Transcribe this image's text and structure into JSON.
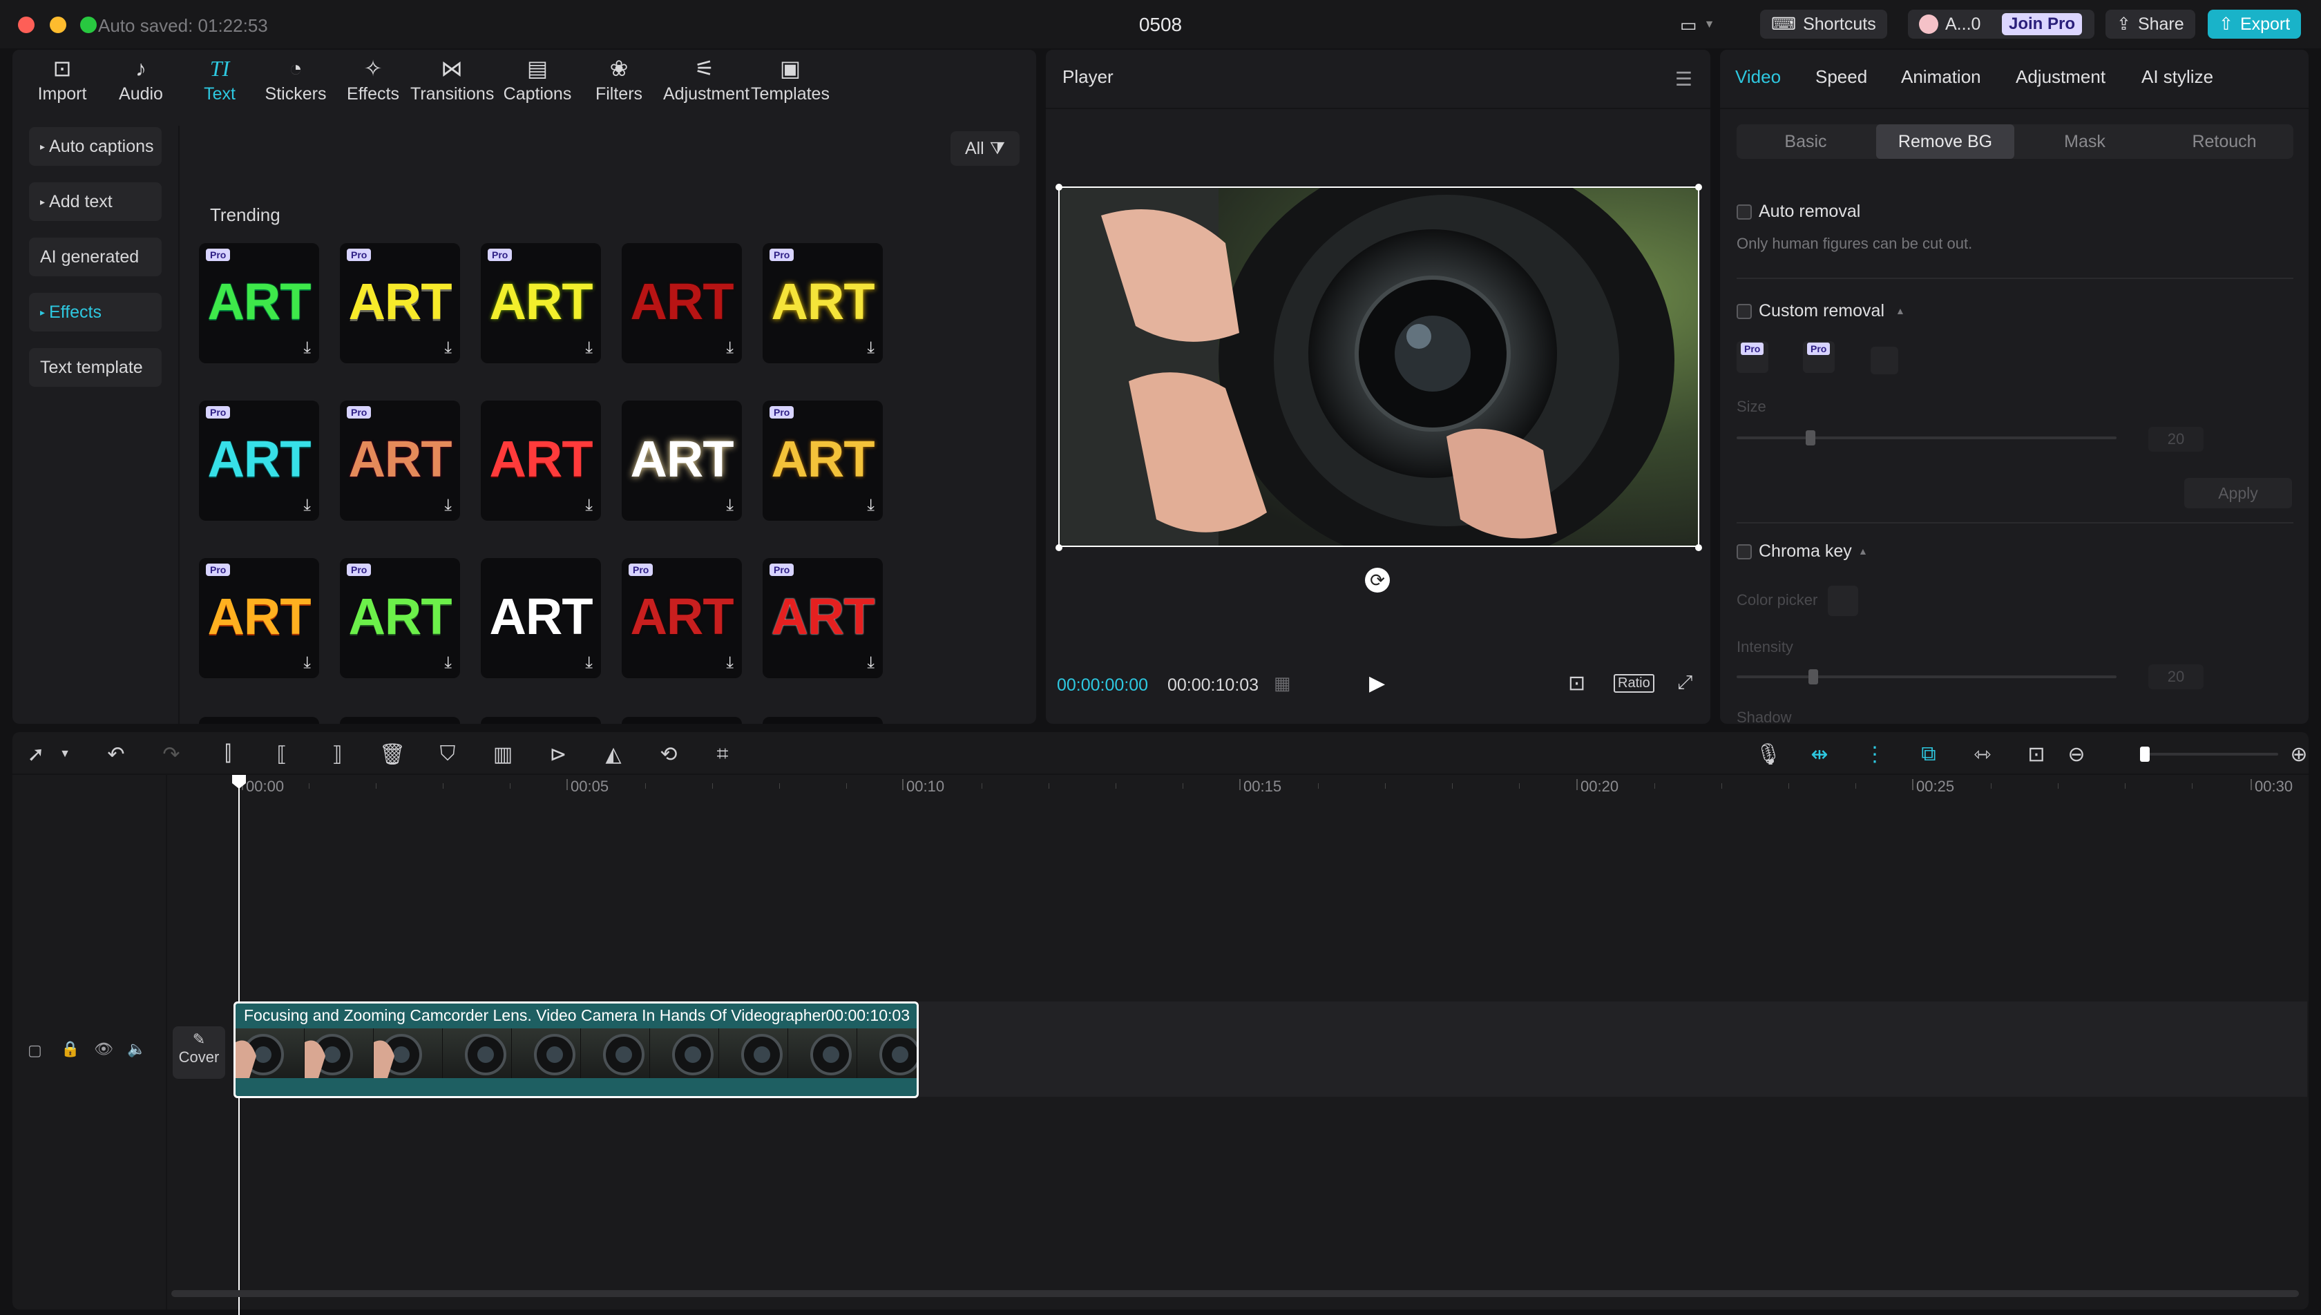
{
  "titlebar": {
    "autosaved": "Auto saved: 01:22:53",
    "project_title": "0508",
    "shortcuts": "Shortcuts",
    "user": "A...0",
    "join_pro": "Join Pro",
    "share": "Share",
    "export": "Export"
  },
  "toolbar": [
    {
      "label": "Import",
      "icon": "import-icon"
    },
    {
      "label": "Audio",
      "icon": "audio-icon"
    },
    {
      "label": "Text",
      "icon": "text-icon",
      "active": true
    },
    {
      "label": "Stickers",
      "icon": "stickers-icon"
    },
    {
      "label": "Effects",
      "icon": "effects-icon"
    },
    {
      "label": "Transitions",
      "icon": "transitions-icon"
    },
    {
      "label": "Captions",
      "icon": "captions-icon"
    },
    {
      "label": "Filters",
      "icon": "filters-icon"
    },
    {
      "label": "Adjustment",
      "icon": "adjustment-icon"
    },
    {
      "label": "Templates",
      "icon": "templates-icon"
    }
  ],
  "sidemenu": [
    "Auto captions",
    "Add text",
    "AI generated",
    "Effects",
    "Text template"
  ],
  "filter": {
    "label": "All"
  },
  "section": {
    "title": "Trending"
  },
  "art_tiles": {
    "label": "ART",
    "pro_badge": "Pro",
    "items": [
      {
        "pro": true,
        "color": "#3ee84a",
        "style": "green-outline"
      },
      {
        "pro": true,
        "color": "#f7ea2a",
        "style": "yellow-dark"
      },
      {
        "pro": true,
        "color": "#f2ef2c",
        "style": "yellow-green"
      },
      {
        "pro": false,
        "color": "#b81414",
        "style": "dark-red"
      },
      {
        "pro": true,
        "color": "#f5e43a",
        "style": "yellow-glow"
      },
      {
        "pro": true,
        "color": "#37e0e8",
        "style": "cyan-outline"
      },
      {
        "pro": true,
        "color": "#e58a5a",
        "style": "copper"
      },
      {
        "pro": false,
        "color": "#ff3b3b",
        "style": "red-pop"
      },
      {
        "pro": false,
        "color": "#ffffff",
        "style": "white-glow"
      },
      {
        "pro": true,
        "color": "#f3c23a",
        "style": "gold"
      },
      {
        "pro": true,
        "color": "#ffb020",
        "style": "orange-gradient"
      },
      {
        "pro": true,
        "color": "#6cf04a",
        "style": "lime"
      },
      {
        "pro": false,
        "color": "#ffffff",
        "style": "white-solid"
      },
      {
        "pro": true,
        "color": "#c91f1f",
        "style": "red-textured"
      },
      {
        "pro": true,
        "color": "#e52020",
        "style": "red-bold"
      }
    ]
  },
  "player": {
    "title": "Player",
    "current_time": "00:00:00:00",
    "total_time": "00:00:10:03",
    "ratio": "Ratio"
  },
  "right_panel": {
    "tabs": [
      "Video",
      "Speed",
      "Animation",
      "Adjustment",
      "AI stylize"
    ],
    "segments": [
      "Basic",
      "Remove BG",
      "Mask",
      "Retouch"
    ],
    "auto_removal": "Auto removal",
    "auto_removal_note": "Only human figures can be cut out.",
    "custom_removal": "Custom removal",
    "size": "Size",
    "size_value": "20",
    "apply": "Apply",
    "chroma_key": "Chroma key",
    "color_picker": "Color picker",
    "intensity": "Intensity",
    "intensity_value": "20",
    "shadow": "Shadow"
  },
  "timeline": {
    "ruler": [
      "00:00",
      "00:05",
      "00:10",
      "00:15",
      "00:20",
      "00:25",
      "00:30"
    ],
    "clip_title": "Focusing and Zooming Camcorder Lens. Video Camera In Hands Of Videographer",
    "clip_duration": "00:00:10:03",
    "cover": "Cover"
  }
}
